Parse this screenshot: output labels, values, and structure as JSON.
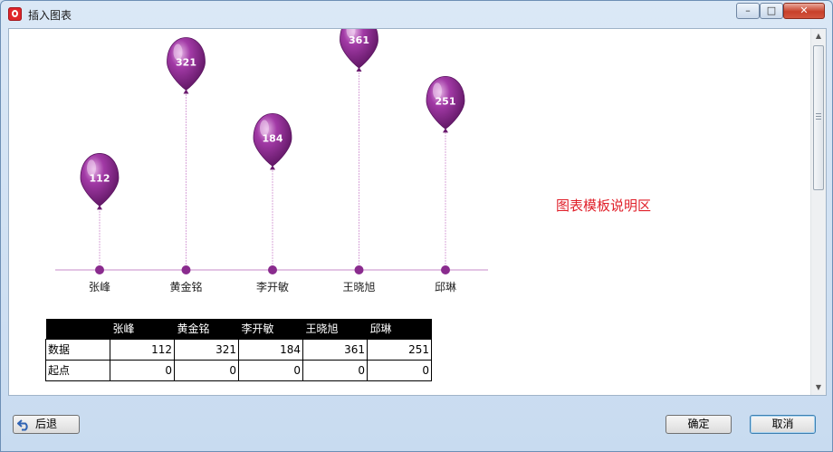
{
  "window": {
    "title": "插入图表"
  },
  "controls": {
    "minimize": "–",
    "maximize": "□",
    "close": "✕"
  },
  "chart_data": {
    "type": "bar",
    "style": "balloon",
    "categories": [
      "张峰",
      "黄金铭",
      "李开敏",
      "王晓旭",
      "邱琳"
    ],
    "values": [
      112,
      321,
      184,
      361,
      251
    ],
    "ylim": [
      0,
      400
    ],
    "color": "#8a2b8e",
    "axis_color": "#c78ac9"
  },
  "template_description": "图表模板说明区",
  "table": {
    "headers": [
      "",
      "张峰",
      "黄金铭",
      "李开敏",
      "王晓旭",
      "邱琳"
    ],
    "rows": [
      {
        "label": "数据",
        "values": [
          "112",
          "321",
          "184",
          "361",
          "251"
        ]
      },
      {
        "label": "起点",
        "values": [
          "0",
          "0",
          "0",
          "0",
          "0"
        ]
      }
    ]
  },
  "buttons": {
    "back": "后退",
    "ok": "确定",
    "cancel": "取消"
  }
}
